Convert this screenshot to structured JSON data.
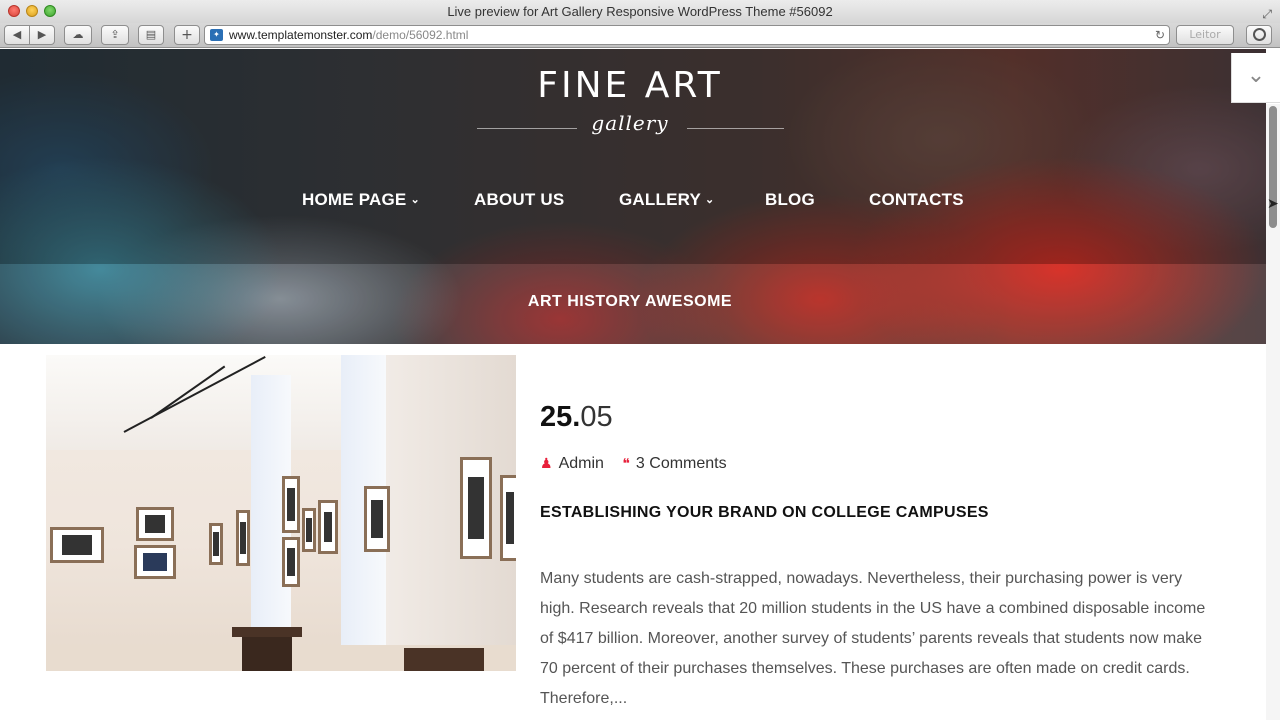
{
  "browser": {
    "window_title": "Live preview for Art Gallery Responsive WordPress Theme #56092",
    "url_domain": "www.templatemonster.com",
    "url_path": "/demo/56092.html",
    "reader_label": "Leitor",
    "add_tab_label": "+"
  },
  "site": {
    "logo_title": "FINE ART",
    "logo_subtitle": "gallery",
    "nav": [
      {
        "label": "HOME PAGE",
        "has_dropdown": true
      },
      {
        "label": "ABOUT US",
        "has_dropdown": false
      },
      {
        "label": "GALLERY",
        "has_dropdown": true
      },
      {
        "label": "BLOG",
        "has_dropdown": false
      },
      {
        "label": "CONTACTS",
        "has_dropdown": false
      }
    ],
    "hero_heading": "ART HISTORY AWESOME"
  },
  "post": {
    "date_day": "25.",
    "date_month": "05",
    "author": "Admin",
    "comments": "3 Comments",
    "title": "ESTABLISHING YOUR BRAND ON COLLEGE CAMPUSES",
    "excerpt": "Many students are cash-strapped, nowadays. Nevertheless, their purchasing power is very high. Research reveals that 20 million students in the US have a combined disposable income of $417 billion. Moreover, another survey of students’ parents reveals that students now make 70 percent of their purchases themselves. These purchases are often made on credit cards. Therefore,..."
  },
  "colors": {
    "accent": "#e8203b",
    "text_dark": "#111111",
    "text_body": "#555555"
  },
  "icons": {
    "author": "user-icon",
    "comments": "comments-icon",
    "scroll_top": "chevron-down-icon"
  }
}
